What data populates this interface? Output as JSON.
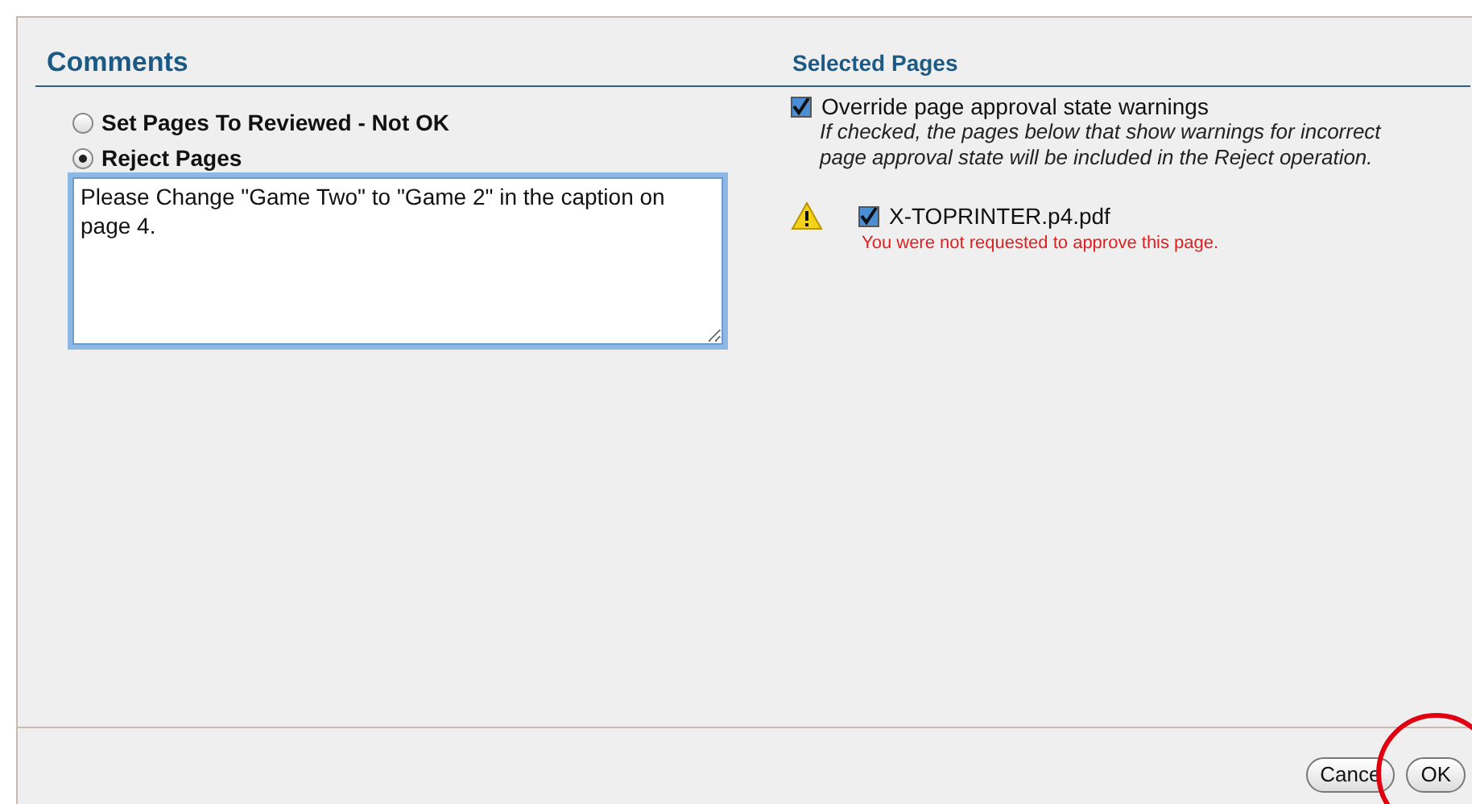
{
  "comments": {
    "title": "Comments",
    "options": [
      {
        "label": "Set Pages To Reviewed - Not OK",
        "selected": false
      },
      {
        "label": "Reject Pages",
        "selected": true
      }
    ],
    "comment_value": "Please Change \"Game Two\" to \"Game 2\" in the caption on page 4."
  },
  "selected_pages": {
    "title": "Selected Pages",
    "override": {
      "label": "Override page approval state warnings",
      "checked": true,
      "hint": "If checked, the pages below that show warnings for incorrect page approval state will be included in the Reject operation."
    },
    "pages": [
      {
        "name": "X-TOPRINTER.p4.pdf",
        "checked": true,
        "warning": "You were not requested to approve this page."
      }
    ]
  },
  "buttons": [
    {
      "label": "Cance"
    },
    {
      "label": "OK"
    }
  ],
  "annotation": {
    "kind": "circle"
  }
}
